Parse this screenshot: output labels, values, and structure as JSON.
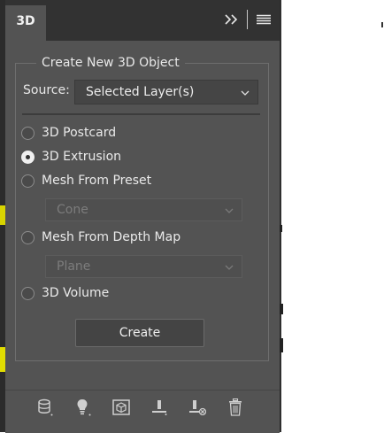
{
  "panel": {
    "tab_label": "3D",
    "expand_icon": "double-chevron-right-icon",
    "menu_icon": "hamburger-menu-icon"
  },
  "create_section": {
    "legend": "Create New 3D Object",
    "source_label": "Source:",
    "source_value": "Selected Layer(s)",
    "options": [
      {
        "label": "3D Postcard",
        "checked": false
      },
      {
        "label": "3D Extrusion",
        "checked": true
      },
      {
        "label": "Mesh From Preset",
        "checked": false
      },
      {
        "label": "Mesh From Depth Map",
        "checked": false
      },
      {
        "label": "3D Volume",
        "checked": false
      }
    ],
    "preset_value": "Cone",
    "depth_map_value": "Plane",
    "create_label": "Create"
  },
  "bottom_toolbar": {
    "icons": [
      "filter-scene-icon",
      "light-bulb-icon",
      "3d-box-icon",
      "ground-plane-icon",
      "ground-plane-remove-icon",
      "trash-icon"
    ]
  }
}
